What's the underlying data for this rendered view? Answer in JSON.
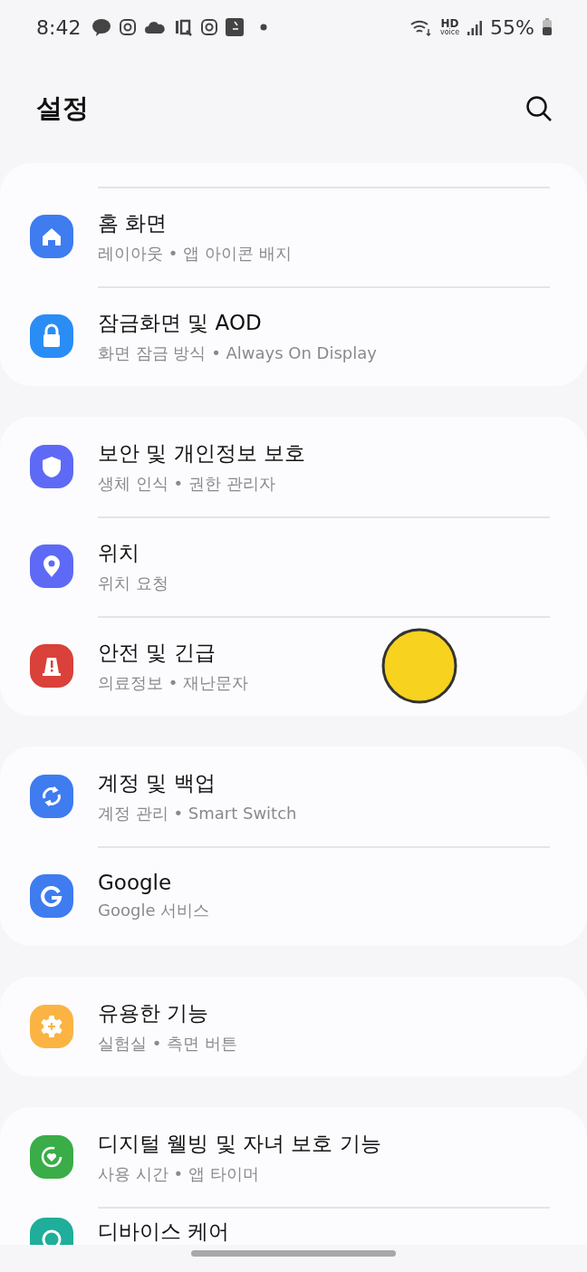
{
  "status_bar": {
    "time": "8:42",
    "hd_label": "HD",
    "hd_sublabel": "voice",
    "battery": "55%"
  },
  "header": {
    "title": "설정"
  },
  "groups": [
    {
      "top_divider": true,
      "items": [
        {
          "kind": "home",
          "color": "#3e7cf0",
          "title": "홈 화면",
          "subtitle": "레이아웃 • 앱 아이콘 배지"
        },
        {
          "kind": "lock",
          "color": "#2a8df5",
          "title": "잠금화면 및 AOD",
          "subtitle": "화면 잠금 방식 • Always On Display"
        }
      ]
    },
    {
      "top_divider": false,
      "items": [
        {
          "kind": "shield",
          "color": "#5e6af5",
          "title": "보안 및 개인정보 보호",
          "subtitle": "생체 인식 • 권한 관리자"
        },
        {
          "kind": "pin",
          "color": "#5e6af5",
          "title": "위치",
          "subtitle": "위치 요청"
        },
        {
          "kind": "alert",
          "color": "#d9413a",
          "title": "안전 및 긴급",
          "subtitle": "의료정보 • 재난문자",
          "sticker": true
        }
      ]
    },
    {
      "top_divider": false,
      "items": [
        {
          "kind": "sync",
          "color": "#3e7cf0",
          "title": "계정 및 백업",
          "subtitle": "계정 관리 • Smart Switch"
        },
        {
          "kind": "google",
          "color": "#3e7cf0",
          "title": "Google",
          "subtitle": "Google 서비스"
        }
      ]
    },
    {
      "top_divider": false,
      "items": [
        {
          "kind": "gear",
          "color": "#fbb443",
          "title": "유용한 기능",
          "subtitle": "실험실 • 측면 버튼"
        }
      ]
    },
    {
      "top_divider": false,
      "items": [
        {
          "kind": "heart",
          "color": "#3aad48",
          "title": "디지털 웰빙 및 자녀 보호 기능",
          "subtitle": "사용 시간 • 앱 타이머"
        },
        {
          "kind": "care",
          "color": "#1fae9b",
          "title": "디바이스 케어"
        }
      ]
    }
  ]
}
